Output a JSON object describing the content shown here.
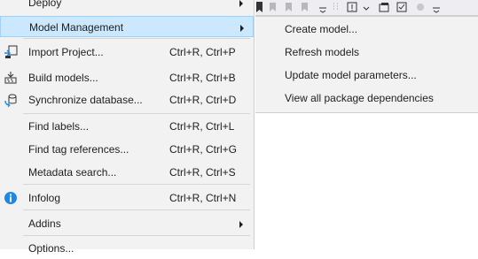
{
  "main_menu": {
    "items": [
      {
        "name": "menu-item-deploy",
        "label": "Deploy",
        "shortcut": "",
        "has_submenu": true
      },
      {
        "name": "menu-item-model-management",
        "label": "Model Management",
        "shortcut": "",
        "has_submenu": true
      },
      {
        "name": "menu-item-import-project",
        "label": "Import Project...",
        "shortcut": "Ctrl+R, Ctrl+P",
        "icon": "import-project-icon"
      },
      {
        "name": "menu-item-build-models",
        "label": "Build models...",
        "shortcut": "Ctrl+R, Ctrl+B",
        "icon": "build-models-icon"
      },
      {
        "name": "menu-item-synchronize-database",
        "label": "Synchronize database...",
        "shortcut": "Ctrl+R, Ctrl+D",
        "icon": "database-sync-icon"
      },
      {
        "name": "menu-item-find-labels",
        "label": "Find labels...",
        "shortcut": "Ctrl+R, Ctrl+L"
      },
      {
        "name": "menu-item-find-tag-references",
        "label": "Find tag references...",
        "shortcut": "Ctrl+R, Ctrl+G"
      },
      {
        "name": "menu-item-metadata-search",
        "label": "Metadata search...",
        "shortcut": "Ctrl+R, Ctrl+S"
      },
      {
        "name": "menu-item-infolog",
        "label": "Infolog",
        "shortcut": "Ctrl+R, Ctrl+N",
        "icon": "info-icon"
      },
      {
        "name": "menu-item-addins",
        "label": "Addins",
        "shortcut": "",
        "has_submenu": true
      },
      {
        "name": "menu-item-options",
        "label": "Options...",
        "shortcut": ""
      }
    ],
    "highlighted": "Model Management"
  },
  "submenu": {
    "items": [
      {
        "label": "Create model..."
      },
      {
        "label": "Refresh models"
      },
      {
        "label": "Update model parameters..."
      },
      {
        "label": "View all package dependencies"
      }
    ]
  },
  "colors": {
    "menu_bg": "#f2f2f2",
    "highlight_bg": "#cce8ff",
    "highlight_border": "#99d1ff",
    "info_blue": "#1e88e5"
  }
}
